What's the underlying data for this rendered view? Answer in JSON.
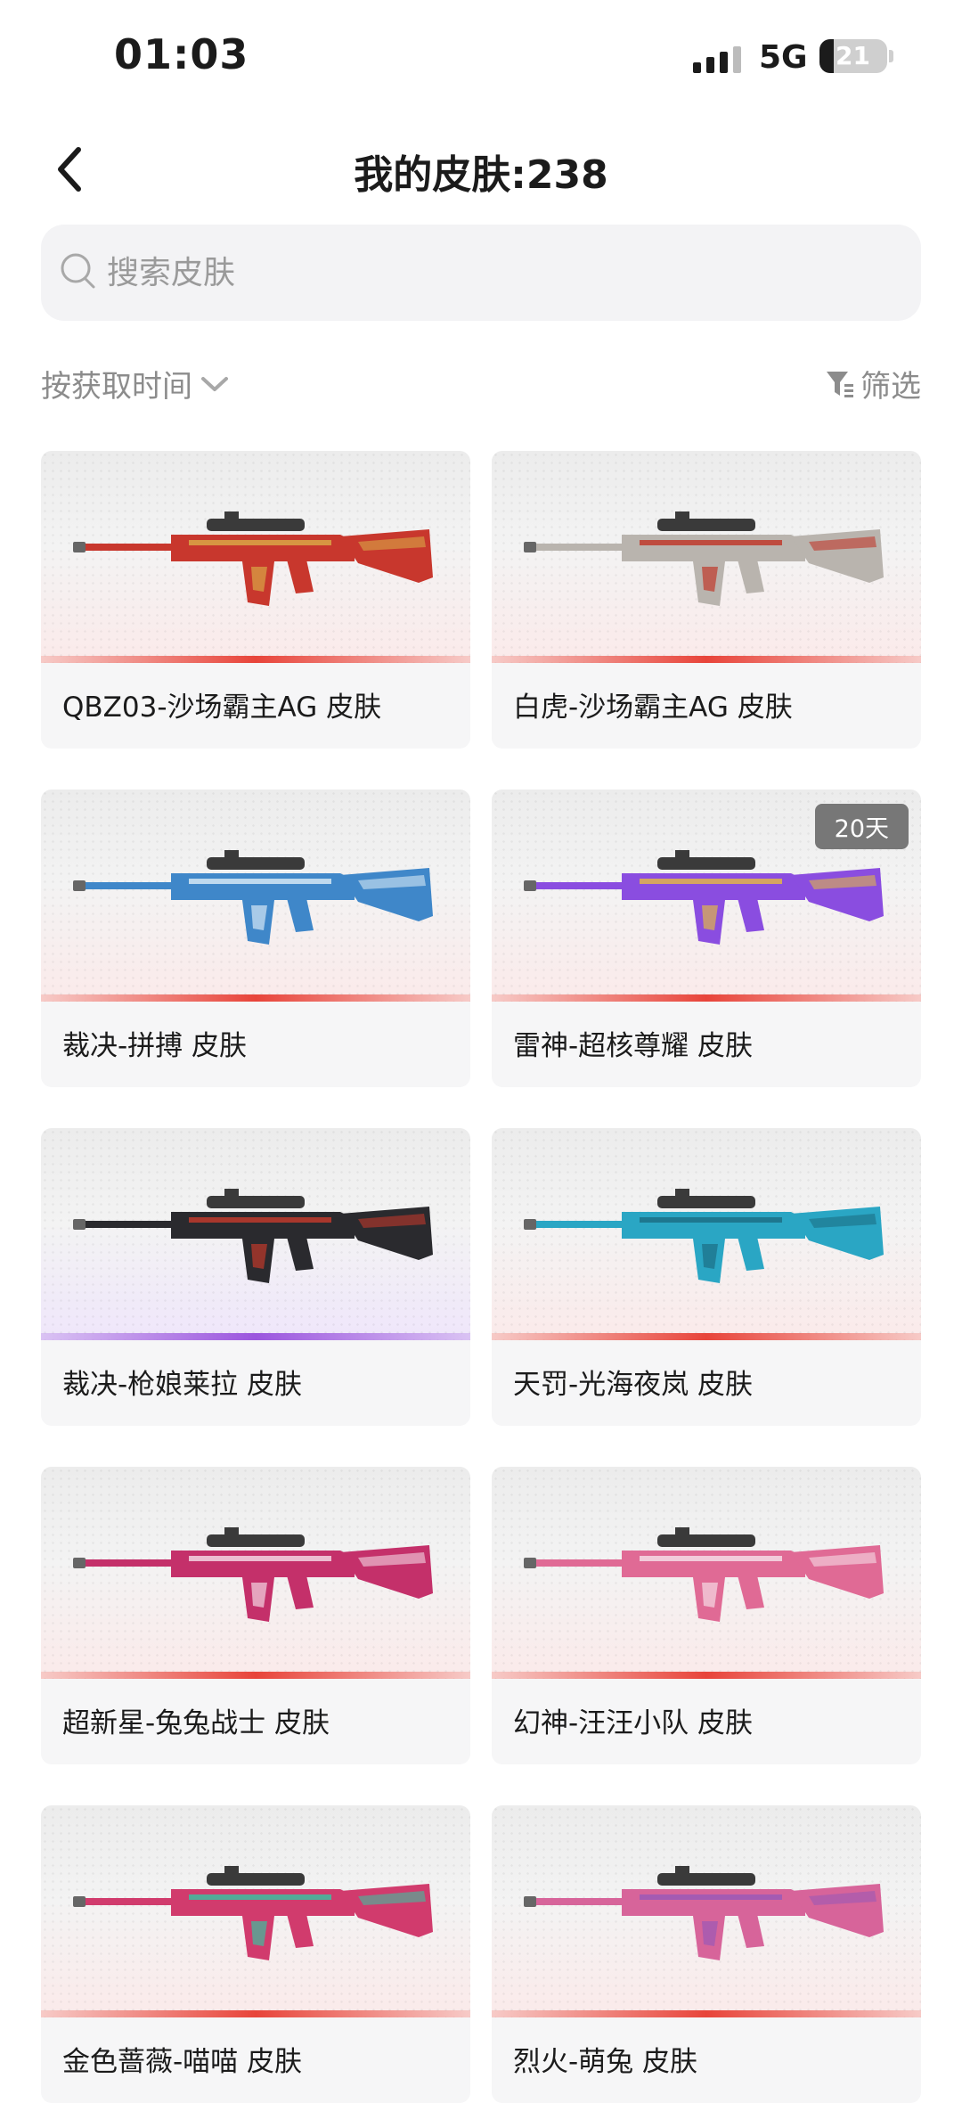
{
  "status_bar": {
    "time": "01:03",
    "network": "5G",
    "battery_level": "21"
  },
  "header": {
    "title": "我的皮肤:238"
  },
  "search": {
    "placeholder": "搜索皮肤"
  },
  "sort": {
    "label": "按获取时间"
  },
  "filter": {
    "label": "筛选"
  },
  "skins": [
    {
      "name": "QBZ03-沙场霸主AG 皮肤",
      "tag": "",
      "theme": "red",
      "gun_color": "#c8372d",
      "accent": "#d9a646"
    },
    {
      "name": "白虎-沙场霸主AG 皮肤",
      "tag": "",
      "theme": "red",
      "gun_color": "#b9b4ae",
      "accent": "#c0392b"
    },
    {
      "name": "裁决-拼搏 皮肤",
      "tag": "",
      "theme": "red",
      "gun_color": "#3f87c9",
      "accent": "#d5e7f5"
    },
    {
      "name": "雷神-超核尊耀 皮肤",
      "tag": "20天",
      "theme": "red",
      "gun_color": "#8a4de0",
      "accent": "#e0b54a"
    },
    {
      "name": "裁决-枪娘莱拉 皮肤",
      "tag": "",
      "theme": "purple",
      "gun_color": "#2a2a2e",
      "accent": "#c0392b"
    },
    {
      "name": "天罚-光海夜岚 皮肤",
      "tag": "",
      "theme": "red",
      "gun_color": "#2aa6c4",
      "accent": "#1c6f86"
    },
    {
      "name": "超新星-兔兔战士 皮肤",
      "tag": "",
      "theme": "red",
      "gun_color": "#c4306a",
      "accent": "#f3d5e2"
    },
    {
      "name": "幻神-汪汪小队 皮肤",
      "tag": "",
      "theme": "red",
      "gun_color": "#e06a95",
      "accent": "#f5dce6"
    },
    {
      "name": "金色蔷薇-喵喵 皮肤",
      "tag": "",
      "theme": "red",
      "gun_color": "#d13b6d",
      "accent": "#3dbfa0"
    },
    {
      "name": "烈火-萌兔 皮肤",
      "tag": "",
      "theme": "red",
      "gun_color": "#d7649a",
      "accent": "#9b59b6"
    }
  ]
}
